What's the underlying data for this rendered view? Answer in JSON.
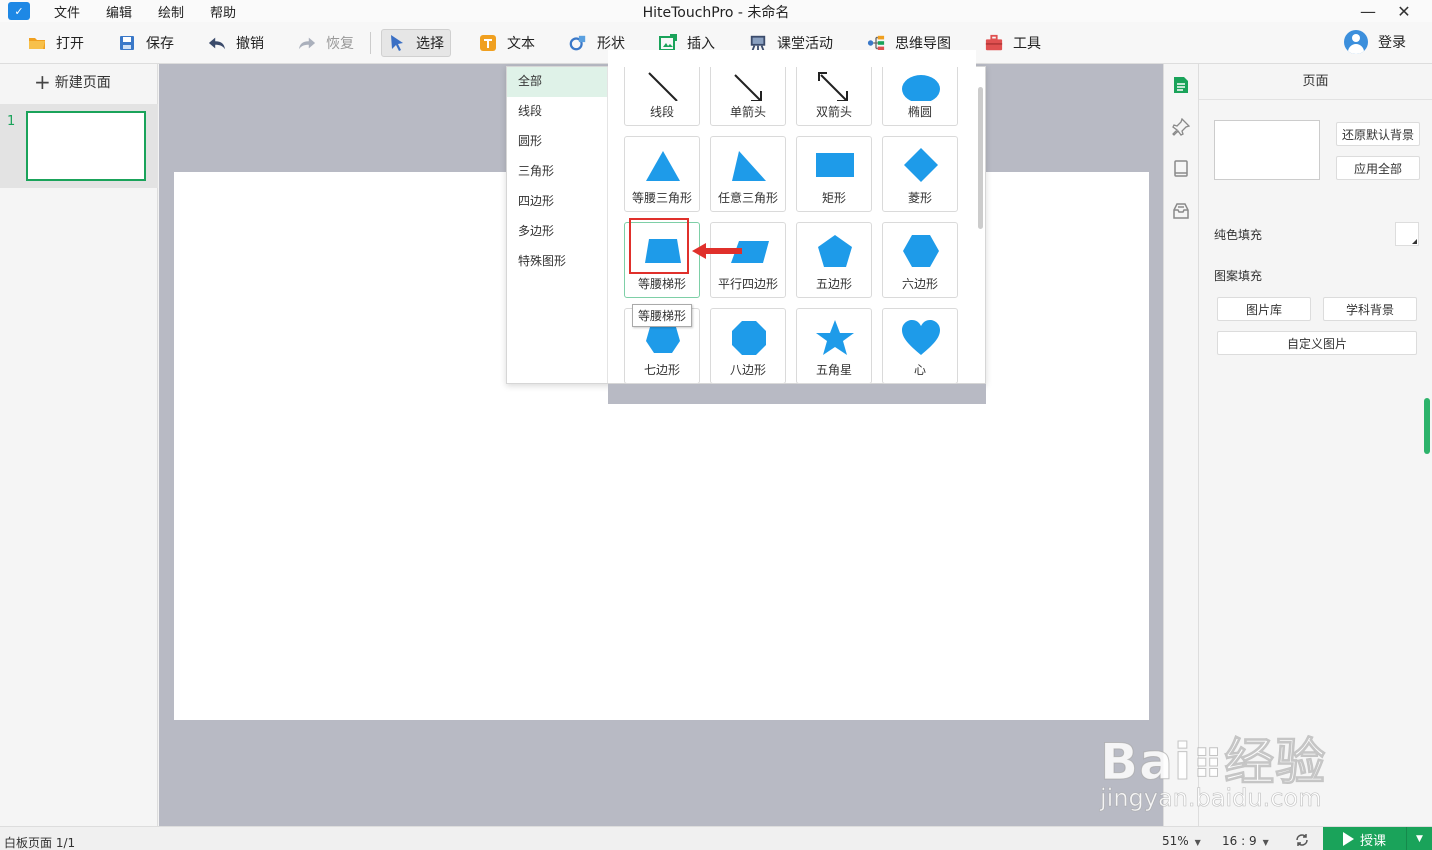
{
  "app": {
    "window_title": "HiteTouchPro - 未命名",
    "menu": [
      "文件",
      "编辑",
      "绘制",
      "帮助"
    ],
    "win_controls": {
      "minimize": "—",
      "close": "✕"
    }
  },
  "toolbar": {
    "open": "打开",
    "save": "保存",
    "undo": "撤销",
    "redo": "恢复",
    "select": "选择",
    "text": "文本",
    "shape": "形状",
    "insert": "插入",
    "classroom": "课堂活动",
    "mindmap": "思维导图",
    "tools": "工具",
    "login": "登录"
  },
  "left_panel": {
    "new_page": "新建页面",
    "pages": [
      {
        "num": "1"
      }
    ]
  },
  "shape_popup": {
    "categories": [
      "全部",
      "线段",
      "圆形",
      "三角形",
      "四边形",
      "多边形",
      "特殊图形"
    ],
    "shapes": [
      "线段",
      "单箭头",
      "双箭头",
      "椭圆",
      "等腰三角形",
      "任意三角形",
      "矩形",
      "菱形",
      "等腰梯形",
      "平行四边形",
      "五边形",
      "六边形",
      "七边形",
      "八边形",
      "五角星",
      "心"
    ],
    "tooltip": "等腰梯形",
    "shape_color": "#1e9be9"
  },
  "right_panel": {
    "title": "页面",
    "restore_bg": "还原默认背景",
    "apply_all": "应用全部",
    "solid_fill": "纯色填充",
    "pattern_fill": "图案填充",
    "gallery": "图片库",
    "subject_bg": "学科背景",
    "custom_image": "自定义图片"
  },
  "status": {
    "page_info": "白板页面 1/1",
    "zoom": "51%",
    "ratio": "16 : 9",
    "teach": "授课"
  },
  "watermark": {
    "brand": "Bai",
    "brand_cn": "经验",
    "url": "jingyan.baidu.com"
  },
  "colors": {
    "accent_green": "#1aa35a",
    "highlight_red": "#e0302b"
  }
}
